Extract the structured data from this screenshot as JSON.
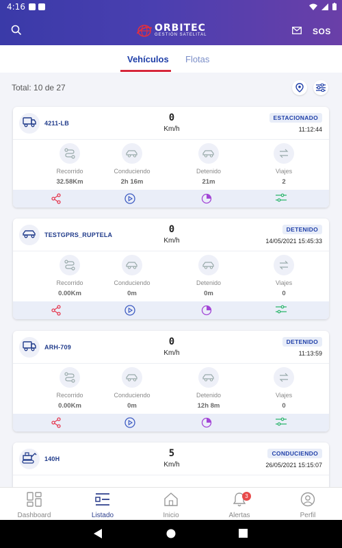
{
  "status_bar": {
    "time": "4:16"
  },
  "header": {
    "brand": "ORBITEC",
    "brand_sub": "GESTIÓN SATELITAL",
    "sos_label": "SOS"
  },
  "tabs": [
    {
      "label": "Vehículos",
      "active": true
    },
    {
      "label": "Flotas",
      "active": false
    }
  ],
  "total_label": "Total: 10 de 27",
  "metric_labels": [
    "Recorrido",
    "Conduciendo",
    "Detenido",
    "Viajes"
  ],
  "vehicles": [
    {
      "plate": "4211-LB",
      "speed": "0",
      "unit": "Km/h",
      "status": "ESTACIONADO",
      "time": "11:12:44",
      "recorrido": "32.58Km",
      "conduciendo": "2h 16m",
      "detenido": "21m",
      "viajes": "2",
      "icon": "truck-icon"
    },
    {
      "plate": "TESTGPRS_RUPTELA",
      "speed": "0",
      "unit": "Km/h",
      "status": "DETENIDO",
      "time": "14/05/2021 15:45:33",
      "recorrido": "0.00Km",
      "conduciendo": "0m",
      "detenido": "0m",
      "viajes": "0",
      "icon": "car-icon"
    },
    {
      "plate": "ARH-709",
      "speed": "0",
      "unit": "Km/h",
      "status": "DETENIDO",
      "time": "11:13:59",
      "recorrido": "0.00Km",
      "conduciendo": "0m",
      "detenido": "12h 8m",
      "viajes": "0",
      "icon": "truck-icon"
    },
    {
      "plate": "140H",
      "speed": "5",
      "unit": "Km/h",
      "status": "CONDUCIENDO",
      "time": "26/05/2021 15:15:07",
      "recorrido": "",
      "conduciendo": "",
      "detenido": "",
      "viajes": "",
      "icon": "machinery-icon"
    }
  ],
  "bottom_nav": [
    {
      "label": "Dashboard",
      "icon": "dashboard-icon",
      "active": false
    },
    {
      "label": "Listado",
      "icon": "list-icon",
      "active": true
    },
    {
      "label": "Inicio",
      "icon": "home-icon",
      "active": false
    },
    {
      "label": "Alertas",
      "icon": "bell-icon",
      "active": false,
      "badge": "3"
    },
    {
      "label": "Perfil",
      "icon": "profile-icon",
      "active": false
    }
  ],
  "colors": {
    "accent": "#1f3fa8",
    "tab_underline": "#d6263a",
    "share": "#e53950",
    "play": "#3d5bc2",
    "report": "#a346d6",
    "settings": "#2ab56a"
  }
}
